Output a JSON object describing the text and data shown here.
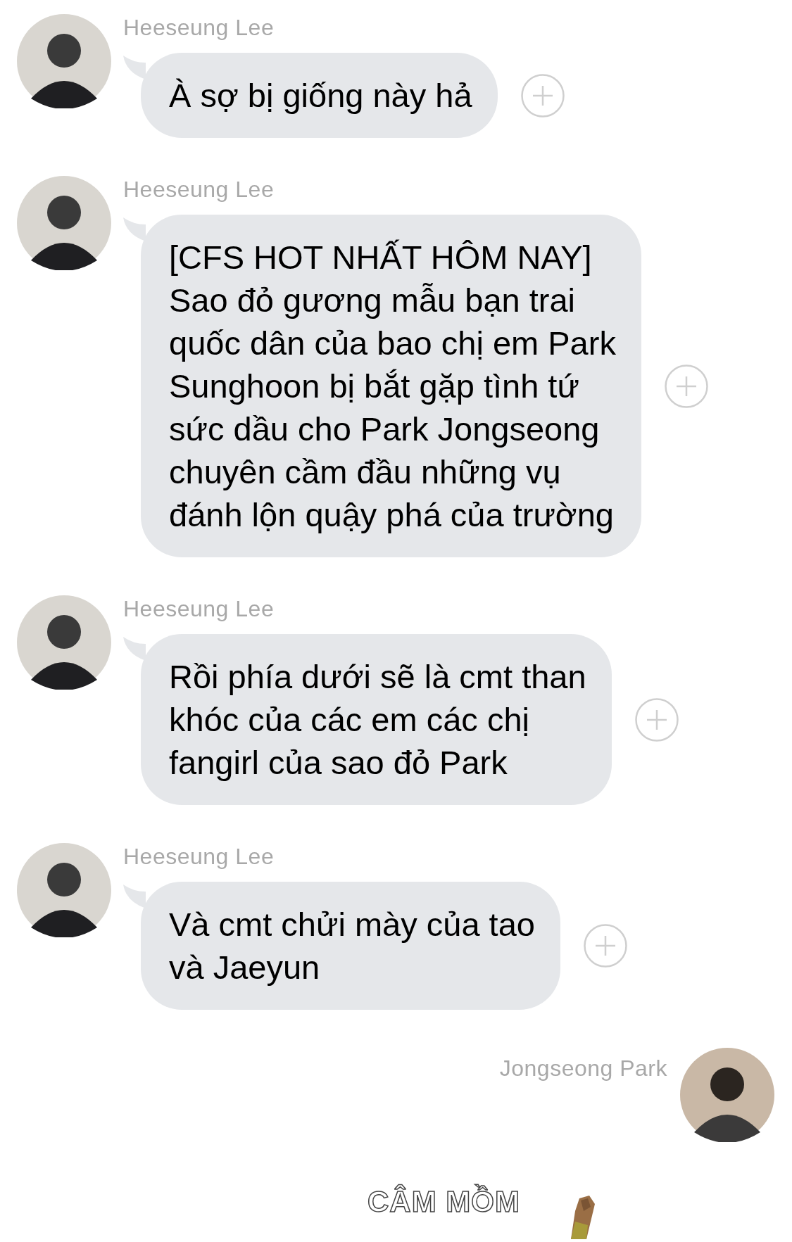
{
  "messages": [
    {
      "sender": "Heeseung Lee",
      "kind": "incoming",
      "lines": [
        "À sợ bị giống này hả"
      ]
    },
    {
      "sender": "Heeseung Lee",
      "kind": "incoming",
      "lines": [
        "[CFS HOT NHẤT HÔM NAY]",
        "Sao đỏ gương mẫu bạn trai",
        "quốc dân của bao chị em Park",
        "Sunghoon bị bắt gặp tình tứ",
        "sức dầu cho Park Jongseong",
        "chuyên cầm đầu những vụ",
        "đánh lộn quậy phá của trường"
      ]
    },
    {
      "sender": "Heeseung Lee",
      "kind": "incoming",
      "lines": [
        "Rồi phía dưới sẽ là cmt than",
        "khóc của các em các chị",
        "fangirl của sao đỏ Park"
      ]
    },
    {
      "sender": "Heeseung Lee",
      "kind": "incoming",
      "lines": [
        "Và cmt chửi mày của tao",
        "và Jaeyun"
      ]
    },
    {
      "sender": "Jongseong Park",
      "kind": "outgoing",
      "sticker": {
        "kind": "picture",
        "caption": "CÂM MỒM"
      }
    }
  ]
}
